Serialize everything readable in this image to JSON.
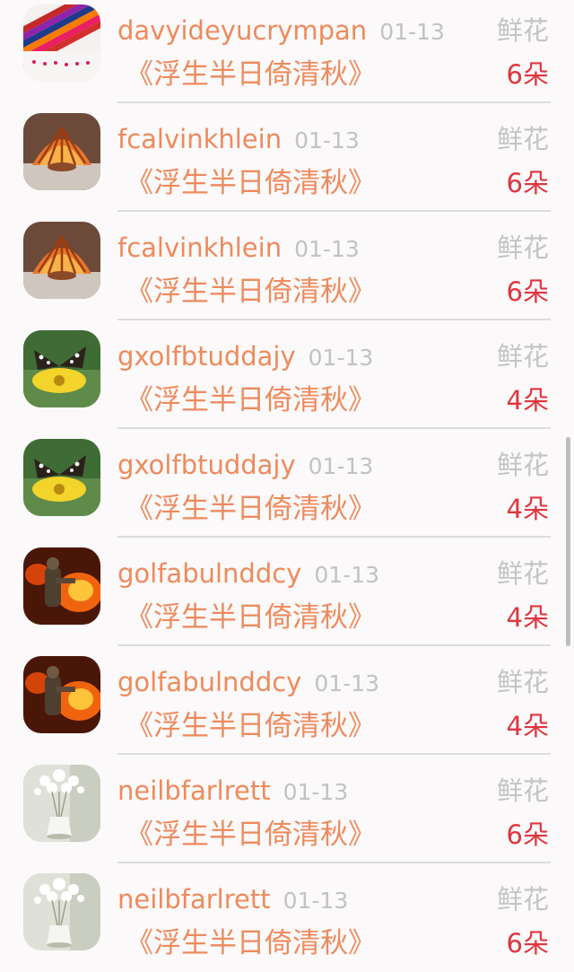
{
  "gifts": [
    {
      "user": "davyideyucrympan",
      "date": "01-13",
      "title": "《浮生半日倚清秋》",
      "type": "鲜花",
      "count": "6朵",
      "avatar": "crayons"
    },
    {
      "user": "fcalvinkhlein",
      "date": "01-13",
      "title": "《浮生半日倚清秋》",
      "type": "鲜花",
      "count": "6朵",
      "avatar": "shell"
    },
    {
      "user": "fcalvinkhlein",
      "date": "01-13",
      "title": "《浮生半日倚清秋》",
      "type": "鲜花",
      "count": "6朵",
      "avatar": "shell"
    },
    {
      "user": "gxolfbtuddajy",
      "date": "01-13",
      "title": "《浮生半日倚清秋》",
      "type": "鲜花",
      "count": "4朵",
      "avatar": "butterfly"
    },
    {
      "user": "gxolfbtuddajy",
      "date": "01-13",
      "title": "《浮生半日倚清秋》",
      "type": "鲜花",
      "count": "4朵",
      "avatar": "butterfly"
    },
    {
      "user": "golfabulnddcy",
      "date": "01-13",
      "title": "《浮生半日倚清秋》",
      "type": "鲜花",
      "count": "4朵",
      "avatar": "fire"
    },
    {
      "user": "golfabulnddcy",
      "date": "01-13",
      "title": "《浮生半日倚清秋》",
      "type": "鲜花",
      "count": "4朵",
      "avatar": "fire"
    },
    {
      "user": "neilbfarlrett",
      "date": "01-13",
      "title": "《浮生半日倚清秋》",
      "type": "鲜花",
      "count": "6朵",
      "avatar": "vase"
    },
    {
      "user": "neilbfarlrett",
      "date": "01-13",
      "title": "《浮生半日倚清秋》",
      "type": "鲜花",
      "count": "6朵",
      "avatar": "vase"
    }
  ],
  "colors": {
    "name": "#ee8a5d",
    "date": "#c2c2c2",
    "type": "#c4c4c4",
    "count": "#e0353f",
    "divider": "#dcdcdc",
    "background": "#fbf9f9"
  }
}
